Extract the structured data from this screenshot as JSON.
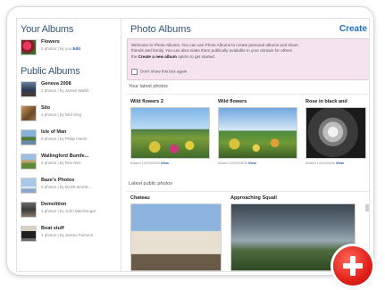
{
  "sidebar": {
    "your_albums_heading": "Your Albums",
    "public_albums_heading": "Public Albums",
    "your_albums": [
      {
        "name": "Flowers",
        "meta": "2 photos | by you",
        "edit": "Edit",
        "thumb": "flowers"
      }
    ],
    "public_albums": [
      {
        "name": "Geneva 2008",
        "meta": "1 photos | by James Walsh",
        "thumb": "geneva"
      },
      {
        "name": "Silo",
        "meta": "1 photos | by Neil Sing",
        "thumb": "silo"
      },
      {
        "name": "Isle of Man",
        "meta": "6 photos | by Philip Harris",
        "thumb": "isle"
      },
      {
        "name": "Wallingford Bumfe...",
        "meta": "2 photos | by Rev Nee",
        "thumb": "walling"
      },
      {
        "name": "Baze's Photos",
        "meta": "5 photos | by BAZE BAZIE...",
        "thumb": "baze"
      },
      {
        "name": "Demolition",
        "meta": "1 photos | by John MacDougal",
        "thumb": "demol"
      },
      {
        "name": "Boat stuff",
        "meta": "1 photos | by James Parsons",
        "thumb": "boat"
      }
    ]
  },
  "main": {
    "title": "Photo Albums",
    "create_link": "Create",
    "welcome_line1": "Welcome to Photo Albums. You can use Photo Albums to create personal albums and share",
    "welcome_line2": "friends and family. You can also make them publically available in your domain for others",
    "welcome_line3_prefix": "the ",
    "welcome_line3_bold": "Create a new album",
    "welcome_line3_suffix": " option to get started.",
    "dont_show": "Don't show this box again",
    "latest_photos_label": "Your latest photos",
    "latest_public_label": "Latest public photos",
    "latest_photos": [
      {
        "title": "Wild flowers 2",
        "meta": "Added 12/09/2008",
        "view": "View"
      },
      {
        "title": "Wild flowers",
        "meta": "Added 12/09/2008",
        "view": "View"
      },
      {
        "title": "Rose in black and",
        "meta": "Added 12/09/2008",
        "view": "View"
      }
    ],
    "public_photos": [
      {
        "title": "Chateau"
      },
      {
        "title": "Approaching Squall"
      }
    ]
  },
  "add_button_icon": "plus-icon"
}
